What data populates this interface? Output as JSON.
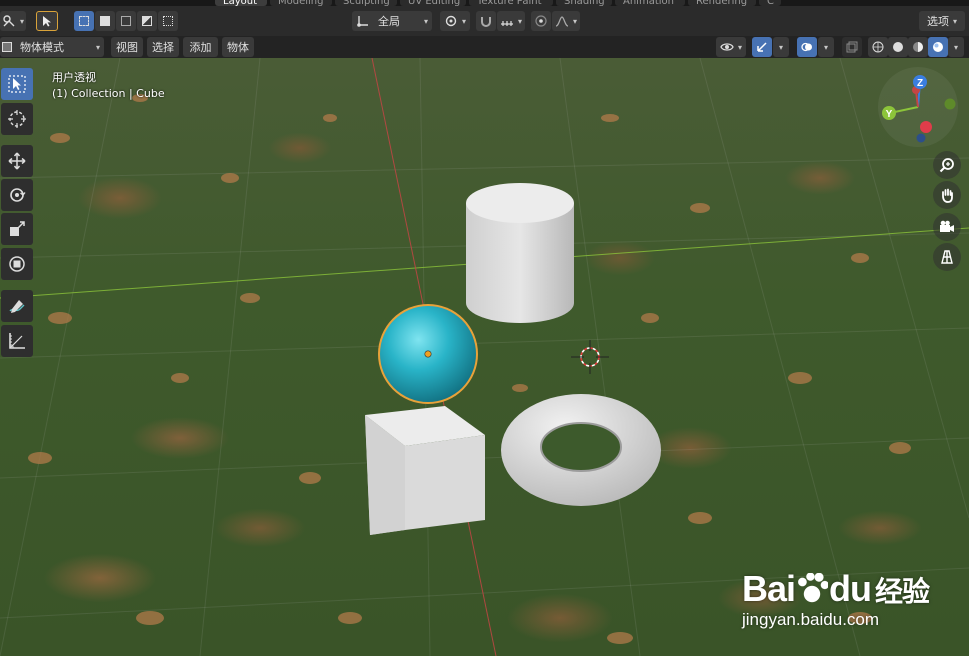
{
  "topbar": {
    "workspace_tabs": [
      "Layout",
      "Modeling",
      "Sculpting",
      "UV Editing",
      "Texture Paint",
      "Shading",
      "Animation",
      "Rendering",
      "C"
    ],
    "active_tab": "Layout"
  },
  "header": {
    "transform_orientation": "全局",
    "options_label": "选项"
  },
  "viewport_header": {
    "mode_label": "物体模式",
    "menus": [
      "视图",
      "选择",
      "添加",
      "物体"
    ]
  },
  "overlay": {
    "view_name": "用户透视",
    "collection_info": "(1) Collection | Cube"
  },
  "gizmo": {
    "z_label": "Z",
    "y_label": "Y"
  },
  "watermark": {
    "brand_prefix": "Bai",
    "brand_suffix": "du",
    "brand_cn": "经验",
    "url": "jingyan.baidu.com"
  },
  "colors": {
    "accent": "#4772b3",
    "sphere": "#29b4c8",
    "selection_outline": "#e8a23a",
    "x_axis": "#c44545",
    "y_axis": "#8cc43a",
    "z_axis": "#3a7ee0"
  },
  "icons": {
    "tools": [
      "select-box-icon",
      "cursor-icon",
      "move-icon",
      "rotate-icon",
      "scale-icon",
      "transform-icon",
      "annotate-icon",
      "measure-icon"
    ],
    "navigation": [
      "zoom-icon",
      "hand-icon",
      "camera-icon",
      "grid-icon"
    ]
  }
}
